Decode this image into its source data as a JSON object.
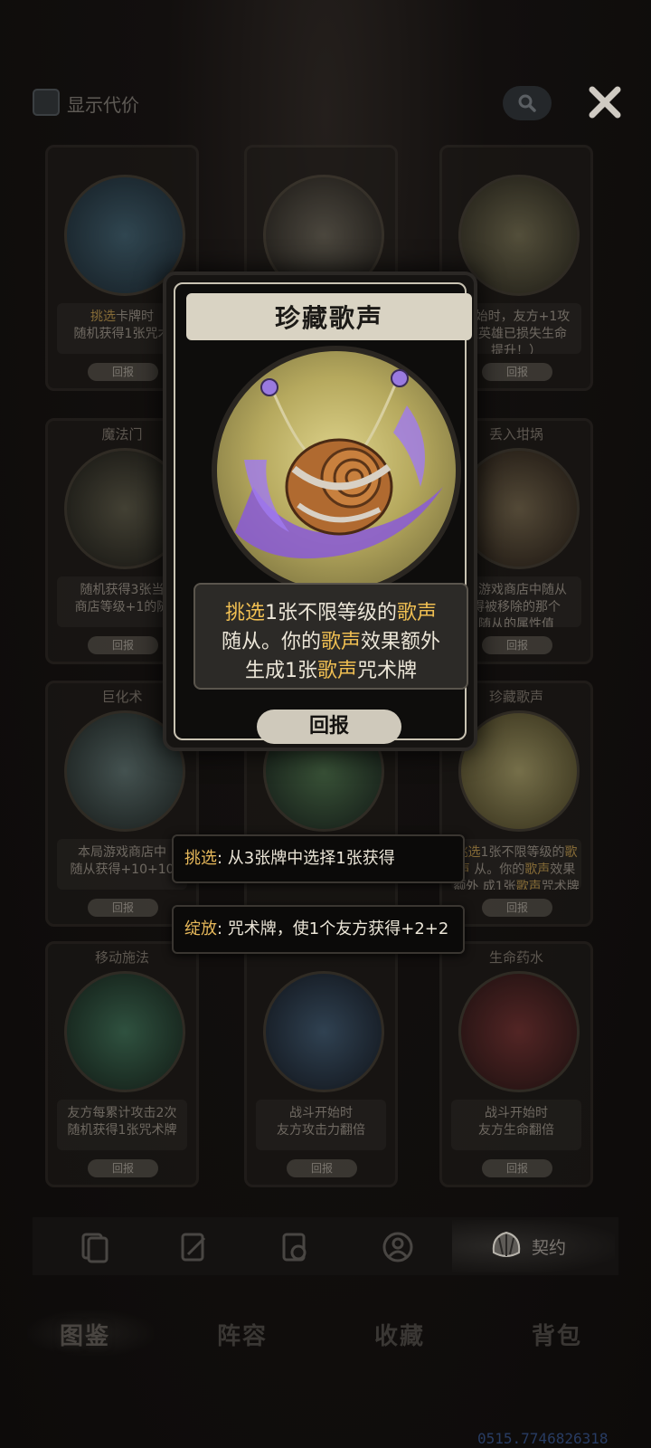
{
  "top_bar": {
    "checkbox_label": "显示代价"
  },
  "grid_cards": [
    {
      "title": "",
      "desc_pre": "",
      "desc_hl": "挑选",
      "desc_post": "卡牌时\n随机获得1张咒术",
      "btn": "回报"
    },
    {
      "title": "",
      "desc_pre": "",
      "desc_hl": "",
      "desc_post": "",
      "btn": ""
    },
    {
      "title": "",
      "desc_pre": "开始时，友方+1攻\n随英雄已损失生命\n提升！）",
      "desc_hl": "",
      "desc_post": "",
      "btn": "回报"
    },
    {
      "title": "魔法门",
      "desc_pre": "随机获得3张当\n商店等级+1的随",
      "desc_hl": "",
      "desc_post": "",
      "btn": "回报"
    },
    {
      "title": "丢入坩埚",
      "desc_pre": "局游戏商店中随从\n得被移除的那个\n随从的属性值",
      "desc_hl": "",
      "desc_post": "",
      "btn": "回报"
    },
    {
      "title": "巨化术",
      "desc_pre": "本局游戏商店中\n随从获得+10+10",
      "desc_hl": "",
      "desc_post": "",
      "btn": "回报"
    },
    {
      "title": "珍藏歌声",
      "desc_pre": "",
      "desc_hl": "",
      "desc_post": "",
      "btn": "回报"
    },
    {
      "title": "移动施法",
      "desc_pre": "友方每累计攻击2次\n随机获得1张咒术牌",
      "desc_hl": "",
      "desc_post": "",
      "btn": "回报"
    },
    {
      "title": "",
      "desc_pre": "战斗开始时\n友方攻击力翻倍",
      "desc_hl": "",
      "desc_post": "",
      "btn": "回报"
    },
    {
      "title": "生命药水",
      "desc_pre": "战斗开始时\n友方生命翻倍",
      "desc_hl": "",
      "desc_post": "",
      "btn": "回报"
    }
  ],
  "grid_card_7_desc": {
    "a": "",
    "b": "挑选",
    "c": "1张不限等级的",
    "d": "歌声",
    "e": "从。你的",
    "f": "歌声",
    "g": "效果额外",
    "h": "成1张",
    "i": "歌声",
    "j": "咒术牌"
  },
  "feature_card": {
    "title": "珍藏歌声",
    "desc_line1_hl1": "挑选",
    "desc_line1_txt": "1张不限等级的",
    "desc_line1_hl2": "歌声",
    "desc_line2_txt1": "随从。你的",
    "desc_line2_hl": "歌声",
    "desc_line2_txt2": "效果额外",
    "desc_line3_txt1": "生成1张",
    "desc_line3_hl": "歌声",
    "desc_line3_txt2": "咒术牌",
    "button": "回报"
  },
  "tooltips": [
    {
      "keyword": "挑选",
      "text": ": 从3张牌中选择1张获得"
    },
    {
      "keyword": "绽放",
      "text": ": 咒术牌，使1个友方获得+2+2"
    }
  ],
  "sub_tabs": {
    "active_label": "契约"
  },
  "main_tabs": [
    "图鉴",
    "阵容",
    "收藏",
    "背包"
  ],
  "version": "0515.7746826318",
  "colors": {
    "keyword": "#e6b85a",
    "background": "#0f0d0c",
    "card_frame": "#c9c3b3"
  }
}
